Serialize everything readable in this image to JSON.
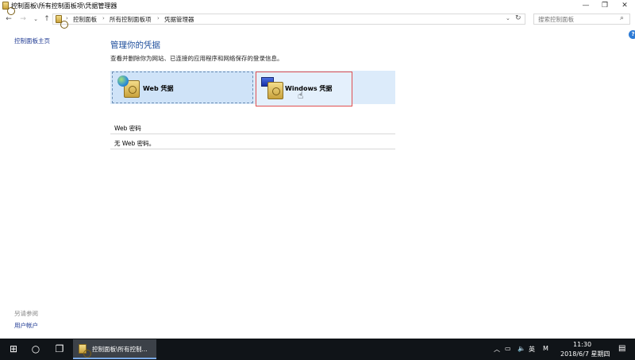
{
  "window": {
    "title": "控制面板\\所有控制面板项\\凭据管理器"
  },
  "breadcrumb": [
    "控制面板",
    "所有控制面板项",
    "凭据管理器"
  ],
  "search": {
    "placeholder": "搜索控制面板"
  },
  "sidebar": {
    "home": "控制面板主页",
    "see_also": "另请参阅",
    "user_accounts": "用户帐户"
  },
  "main": {
    "heading": "管理你的凭据",
    "description": "查看并删除你为网站、已连接的应用程序和网络保存的登录信息。",
    "cards": [
      {
        "label": "Web 凭据"
      },
      {
        "label": "Windows 凭据"
      }
    ],
    "section_title": "Web 密码",
    "empty_text": "无 Web 密码。"
  },
  "taskbar": {
    "task_label": "控制面板\\所有控制...",
    "ime_lang": "英",
    "ime_mode": "M",
    "time": "11:30",
    "date": "2018/6/7 星期四"
  },
  "icons": {
    "help": "?"
  }
}
